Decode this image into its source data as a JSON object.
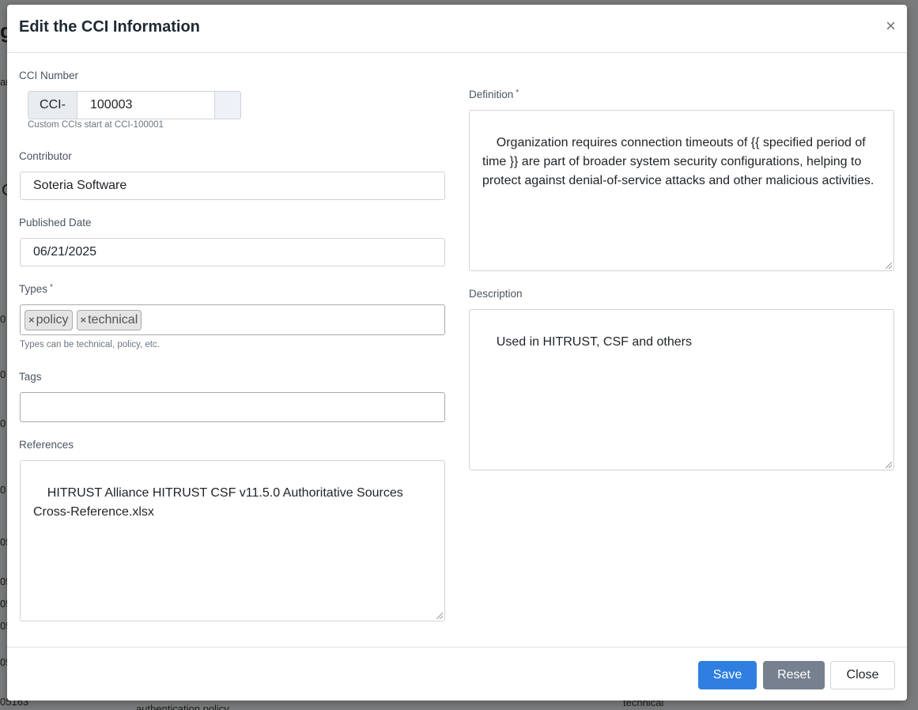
{
  "background": {
    "fragments": [
      "g",
      "ar",
      "C",
      "0",
      "0",
      "0",
      "0",
      "05",
      "05",
      "05",
      "05",
      "05",
      "05163",
      "authentication policy",
      "technical"
    ]
  },
  "modal": {
    "title": "Edit the CCI Information",
    "close_icon": "×"
  },
  "form": {
    "cci_number": {
      "label": "CCI Number",
      "prefix": "CCI-",
      "value": "100003",
      "hint": "Custom CCIs start at CCI-100001"
    },
    "contributor": {
      "label": "Contributor",
      "value": "Soteria Software"
    },
    "published_date": {
      "label": "Published Date",
      "value": "06/21/2025"
    },
    "types": {
      "label": "Types",
      "required_mark": "*",
      "chips": [
        {
          "remove": "×",
          "label": "policy"
        },
        {
          "remove": "×",
          "label": "technical"
        }
      ],
      "hint": "Types can be technical, policy, etc."
    },
    "tags": {
      "label": "Tags",
      "value": ""
    },
    "references": {
      "label": "References",
      "value": "HITRUST Alliance HITRUST CSF v11.5.0 Authoritative Sources Cross-Reference.xlsx"
    },
    "definition": {
      "label": "Definition",
      "required_mark": "*",
      "value": "Organization requires connection timeouts of {{ specified period of time }} are part of broader system security configurations, helping to protect against denial-of-service attacks and other malicious activities."
    },
    "description": {
      "label": "Description",
      "value": "Used in HITRUST, CSF and others"
    }
  },
  "footer": {
    "save_label": "Save",
    "reset_label": "Reset",
    "close_label": "Close"
  },
  "colors": {
    "primary": "#2f7fe0",
    "secondary": "#76808e"
  }
}
